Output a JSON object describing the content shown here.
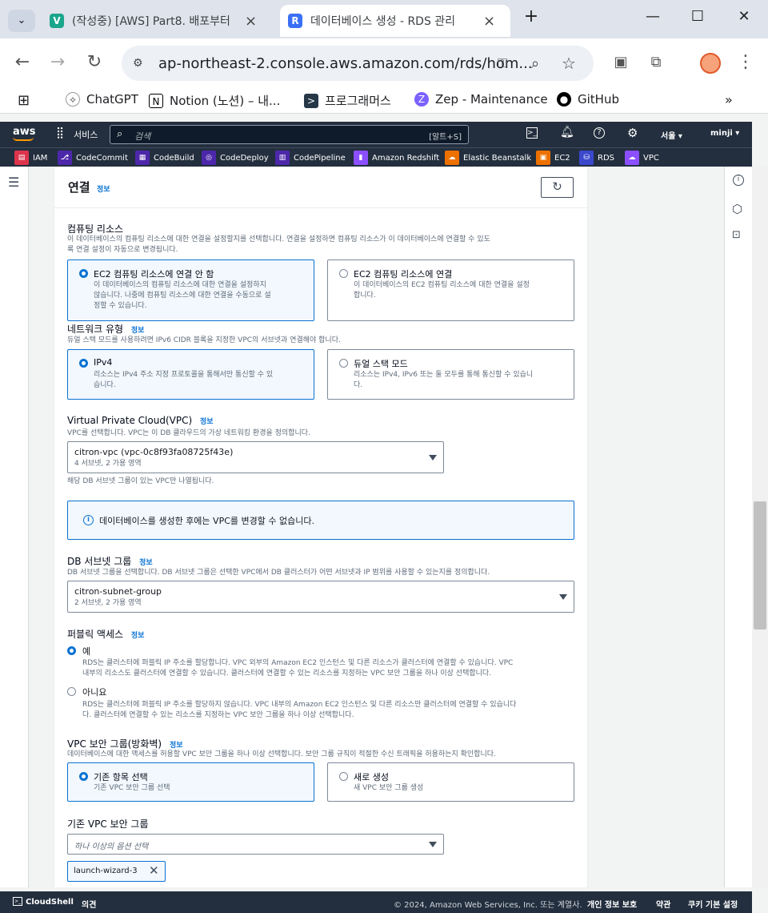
{
  "browser": {
    "tabs": [
      {
        "title": "(작성중) [AWS] Part8. 배포부터",
        "fav": "V",
        "fav_color": "#1aa68c"
      },
      {
        "title": "데이터베이스 생성 - RDS 관리",
        "fav": "R",
        "fav_color": "#3b6ff5"
      }
    ],
    "url": "ap-northeast-2.console.aws.amazon.com/rds/hom...",
    "bookmarks": [
      "ChatGPT",
      "Notion (노션) – 내...",
      "프로그래머스",
      "Zep - Maintenance",
      "GitHub"
    ]
  },
  "aws": {
    "logo": "aws",
    "services_label": "서비스",
    "search_placeholder": "검색",
    "search_shortcut": "[알트+S]",
    "region": "서울 ▾",
    "user": "minji ▾",
    "service_shortcuts": [
      {
        "label": "IAM",
        "color": "#dd344c"
      },
      {
        "label": "CodeCommit",
        "color": "#4d27aa"
      },
      {
        "label": "CodeBuild",
        "color": "#4d27aa"
      },
      {
        "label": "CodeDeploy",
        "color": "#4d27aa"
      },
      {
        "label": "CodePipeline",
        "color": "#4d27aa"
      },
      {
        "label": "Amazon Redshift",
        "color": "#8c4fff"
      },
      {
        "label": "Elastic Beanstalk",
        "color": "#ed7100"
      },
      {
        "label": "EC2",
        "color": "#ed7100"
      },
      {
        "label": "RDS",
        "color": "#3b48cc"
      },
      {
        "label": "VPC",
        "color": "#8c4fff"
      }
    ]
  },
  "section": {
    "title": "연결",
    "info": "정보"
  },
  "compute": {
    "label": "컴퓨팅 리소스",
    "desc1": "이 데이터베이스의 컴퓨팅 리소스에 대한 연결을 설정할지를 선택합니다. 연결을 설정하면 컴퓨팅 리소스가 이 데이터베이스에 연결할 수 있도",
    "desc2": "록 연결 설정이 자동으로 변경됩니다.",
    "opt1_title": "EC2 컴퓨팅 리소스에 연결 안 함",
    "opt1_d1": "이 데이터베이스의 컴퓨팅 리소스에 대한 연결을 설정하지",
    "opt1_d2": "않습니다. 나중에 컴퓨팅 리소스에 대한 연결을 수동으로 설",
    "opt1_d3": "정할 수 있습니다.",
    "opt2_title": "EC2 컴퓨팅 리소스에 연결",
    "opt2_d1": "이 데이터베이스의 EC2 컴퓨팅 리소스에 대한 연결을 설정",
    "opt2_d2": "합니다."
  },
  "network": {
    "label": "네트워크 유형",
    "info": "정보",
    "desc": "듀얼 스택 모드를 사용하려면 IPv6 CIDR 블록을 지정한 VPC의 서브넷과 연결해야 합니다.",
    "opt1_title": "IPv4",
    "opt1_d1": "리소스는 IPv4 주소 지정 프로토콜을 통해서만 통신할 수 있",
    "opt1_d2": "습니다.",
    "opt2_title": "듀얼 스택 모드",
    "opt2_d1": "리소스는 IPv4, IPv6 또는 둘 모두를 통해 통신할 수 있습니",
    "opt2_d2": "다."
  },
  "vpc": {
    "label": "Virtual Private Cloud(VPC)",
    "info": "정보",
    "desc": "VPC를 선택합니다. VPC는 이 DB 클라우드의 가상 네트워킹 환경을 정의합니다.",
    "value": "citron-vpc (vpc-0c8f93fa08725f43e)",
    "sub": "4 서브넷, 2 가용 영역",
    "hint": "해당 DB 서브넷 그룹이 있는 VPC만 나열됩니다.",
    "alert": "데이터베이스를 생성한 후에는 VPC를 변경할 수 없습니다."
  },
  "subnet": {
    "label": "DB 서브넷 그룹",
    "info": "정보",
    "desc": "DB 서브넷 그룹을 선택합니다. DB 서브넷 그룹은 선택한 VPC에서 DB 클러스터가 어떤 서브넷과 IP 범위를 사용할 수 있는지를 정의합니다.",
    "value": "citron-subnet-group",
    "sub": "2 서브넷, 2 가용 영역"
  },
  "public": {
    "label": "퍼블릭 액세스",
    "info": "정보",
    "yes": "예",
    "yes_d1": "RDS는 클러스터에 퍼블릭 IP 주소를 할당합니다. VPC 외부의 Amazon EC2 인스턴스 및 다른 리소스가 클러스터에 연결할 수 있습니다. VPC",
    "yes_d2": "내부의 리소스도 클러스터에 연결할 수 있습니다. 클러스터에 연결할 수 있는 리소스를 지정하는 VPC 보안 그룹을 하나 이상 선택합니다.",
    "no": "아니요",
    "no_d1": "RDS는 클러스터에 퍼블릭 IP 주소를 할당하지 않습니다. VPC 내부의 Amazon EC2 인스턴스 및 다른 리소스만 클러스터에 연결할 수 있습니다",
    "no_d2": "다. 클러스터에 연결할 수 있는 리소스를 지정하는 VPC 보안 그룹을 하나 이상 선택합니다."
  },
  "sg": {
    "label": "VPC 보안 그룹(방화벽)",
    "info": "정보",
    "desc": "데이터베이스에 대한 액세스를 허용할 VPC 보안 그룹을 하나 이상 선택합니다. 보안 그룹 규칙이 적절한 수신 트래픽을 허용하는지 확인합니다.",
    "opt1_title": "기존 항목 선택",
    "opt1_d": "기존 VPC 보안 그룹 선택",
    "opt2_title": "새로 생성",
    "opt2_d": "새 VPC 보안 그룹 생성"
  },
  "existing_sg": {
    "label": "기존 VPC 보안 그룹",
    "placeholder": "하나 이상의 옵션 선택",
    "token": "launch-wizard-3"
  },
  "footer": {
    "cloudshell": "CloudShell",
    "feedback": "의견",
    "copyright": "© 2024, Amazon Web Services, Inc. 또는 계열사.",
    "privacy": "개인 정보 보호",
    "terms": "약관",
    "cookies": "쿠키 기본 설정"
  }
}
